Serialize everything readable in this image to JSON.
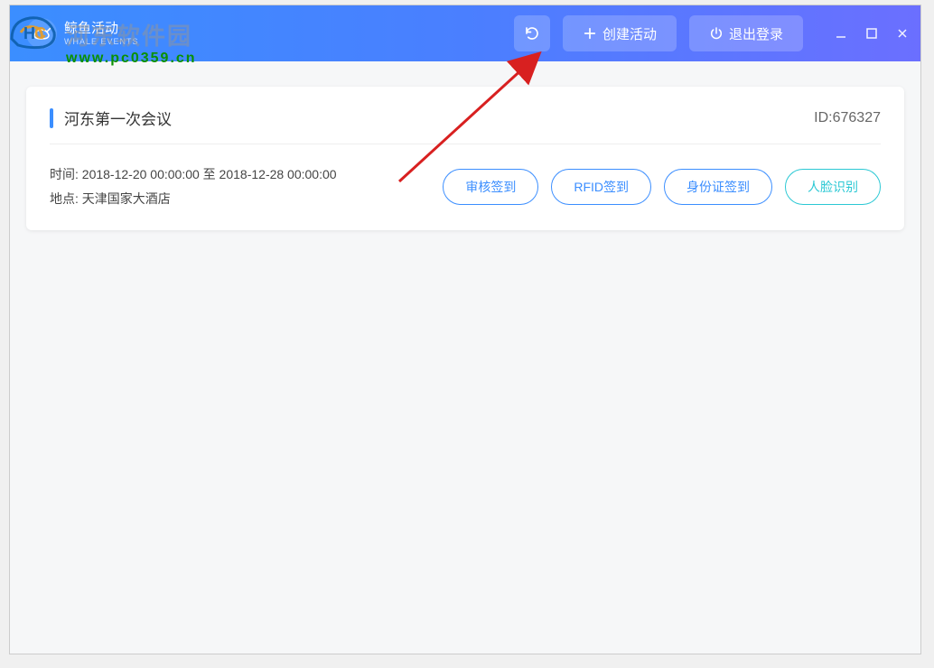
{
  "watermark": {
    "text": "河东软件园",
    "url": "www.pc0359.cn"
  },
  "app": {
    "name_cn": "鲸鱼活动",
    "name_en": "WHALE EVENTS"
  },
  "header": {
    "refresh_label": "",
    "create_label": "创建活动",
    "logout_label": "退出登录"
  },
  "event": {
    "title": "河东第一次会议",
    "id_label": "ID:676327",
    "time_label": "时间:",
    "time_value": "2018-12-20 00:00:00 至 2018-12-28 00:00:00",
    "location_label": "地点:",
    "location_value": "天津国家大酒店",
    "actions": {
      "review": "审核签到",
      "rfid": "RFID签到",
      "idcard": "身份证签到",
      "face": "人脸识别"
    }
  }
}
